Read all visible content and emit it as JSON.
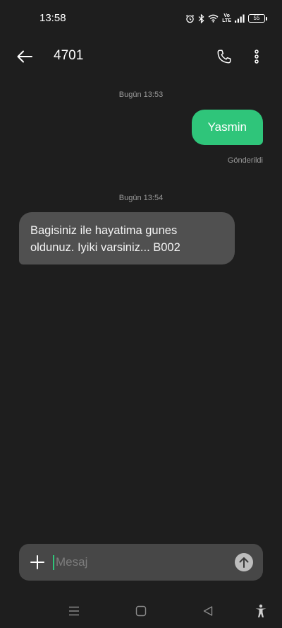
{
  "status_bar": {
    "time": "13:58",
    "icons": [
      "alarm-icon",
      "bluetooth-icon",
      "wifi-icon",
      "volte-icon",
      "signal-icon",
      "battery-icon"
    ],
    "volte_top": "Vo",
    "volte_bottom": "LTE",
    "battery_level": "55"
  },
  "app_bar": {
    "contact": "4701",
    "icons": [
      "back-arrow-icon",
      "phone-icon",
      "more-vertical-icon"
    ]
  },
  "conversation": {
    "messages": [
      {
        "timestamp": "Bugün 13:53",
        "direction": "outgoing",
        "text": "Yasmin",
        "status": "Gönderildi"
      },
      {
        "timestamp": "Bugün 13:54",
        "direction": "incoming",
        "text": "Bagisiniz ile hayatima gunes oldunuz. Iyiki varsiniz... B002"
      }
    ]
  },
  "composer": {
    "placeholder": "Mesaj",
    "value": "",
    "icons": [
      "plus-icon",
      "send-arrow-up-icon"
    ]
  },
  "nav_bar": {
    "icons": [
      "menu-icon",
      "home-square-icon",
      "back-triangle-icon",
      "accessibility-icon"
    ]
  },
  "colors": {
    "background": "#1e1e1e",
    "outgoing_bubble": "#2fc57a",
    "incoming_bubble": "#505050",
    "composer": "#474747",
    "accent": "#2fc57a"
  }
}
